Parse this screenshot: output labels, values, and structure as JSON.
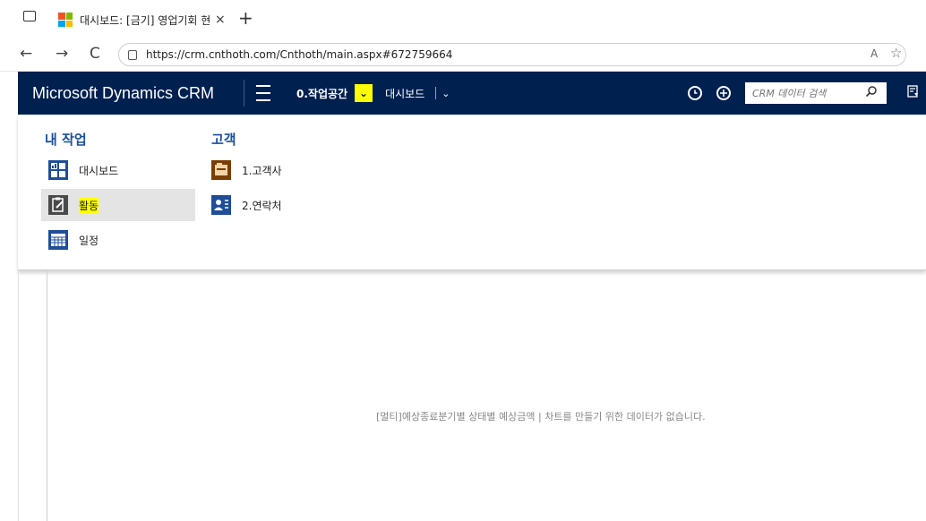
{
  "browser": {
    "tab_title": "대시보드: [금기] 영업기회 현황 - M",
    "tab_close": "×",
    "new_tab": "+",
    "back": "←",
    "forward": "→",
    "refresh": "C",
    "url": "https://crm.cnthoth.com/Cnthoth/main.aspx#672759664",
    "read_aloud": "A",
    "favorite": "☆"
  },
  "crm": {
    "brand": "Microsoft Dynamics CRM",
    "workspace_label": "0.작업공간",
    "workspace_chevron": "⌄",
    "dashboard_label": "대시보드",
    "dashboard_chevron": "⌄",
    "search_placeholder": "CRM 데이터 검색",
    "history_icon": "history-icon",
    "create_icon": "plus-icon",
    "accent_color": "#002050",
    "highlight_color": "#ffff00"
  },
  "menu": {
    "my_work": {
      "heading": "내 작업",
      "items": [
        {
          "label": "대시보드",
          "icon": "dashboard-icon"
        },
        {
          "label": "활동",
          "icon": "activity-icon",
          "active": true
        },
        {
          "label": "일정",
          "icon": "calendar-icon"
        }
      ]
    },
    "customer": {
      "heading": "고객",
      "items": [
        {
          "label": "1.고객사",
          "icon": "account-icon"
        },
        {
          "label": "2.연락처",
          "icon": "contact-icon"
        }
      ]
    }
  },
  "content": {
    "no_data_message": "[멀티]예상종료분기별 상태별 예상금액 | 차트를 만들기 위한 데이터가 없습니다."
  }
}
